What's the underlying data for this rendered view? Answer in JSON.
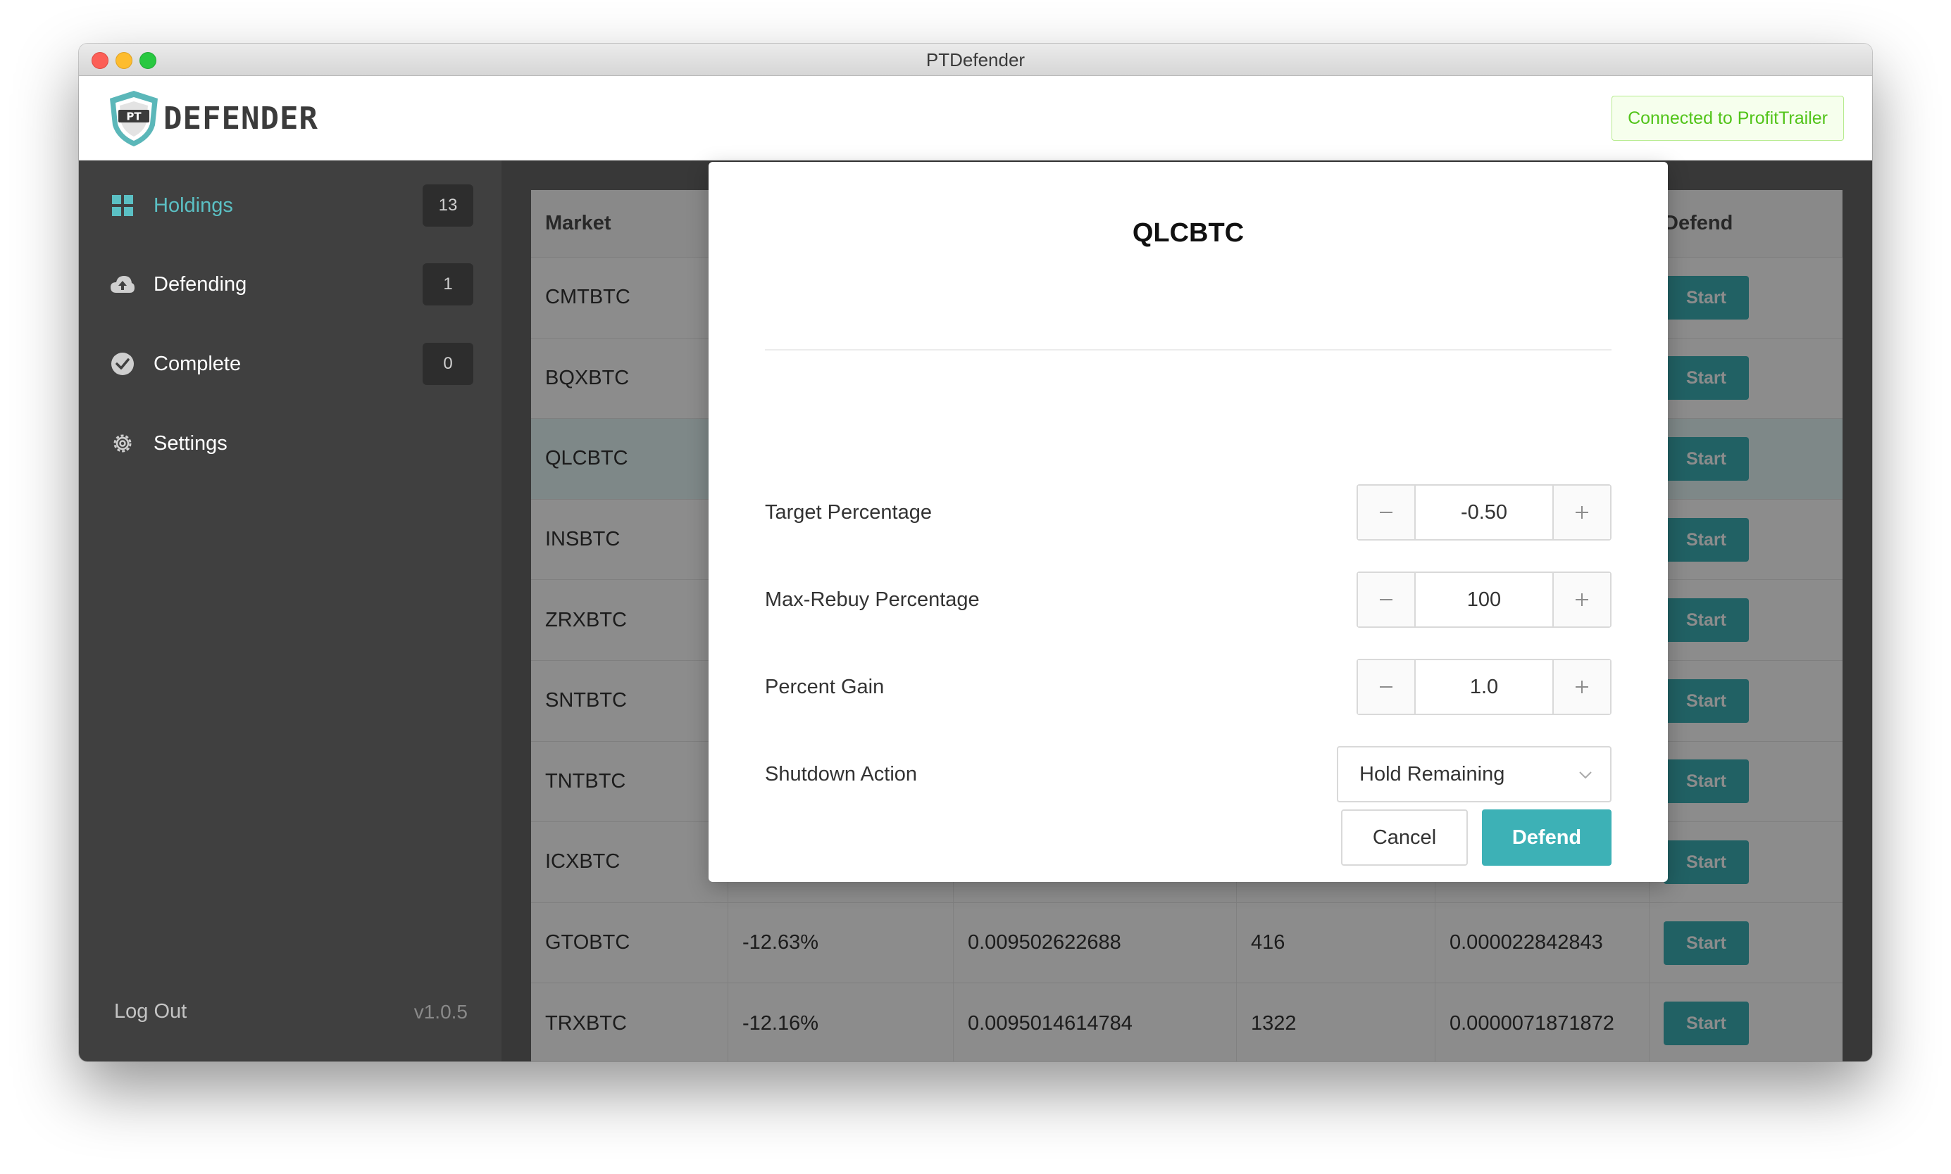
{
  "window": {
    "title": "PTDefender"
  },
  "header": {
    "logo_text": "DEFENDER",
    "logo_badge": "PT",
    "status": "Connected to ProfitTrailer"
  },
  "sidebar": {
    "items": [
      {
        "label": "Holdings",
        "badge": "13",
        "icon": "grid-icon",
        "active": true
      },
      {
        "label": "Defending",
        "badge": "1",
        "icon": "cloud-upload-icon"
      },
      {
        "label": "Complete",
        "badge": "0",
        "icon": "check-circle-icon"
      },
      {
        "label": "Settings",
        "icon": "gear-icon"
      }
    ],
    "logout": "Log Out",
    "version": "v1.0.5"
  },
  "table": {
    "columns": [
      "Market",
      "",
      "",
      "",
      "",
      "Defend"
    ],
    "start_label": "Start",
    "rows": [
      {
        "market": "CMTBTC"
      },
      {
        "market": "BQXBTC"
      },
      {
        "market": "QLCBTC",
        "selected": true
      },
      {
        "market": "INSBTC"
      },
      {
        "market": "ZRXBTC"
      },
      {
        "market": "SNTBTC"
      },
      {
        "market": "TNTBTC"
      },
      {
        "market": "ICXBTC"
      },
      {
        "market": "GTOBTC",
        "c2": "-12.63%",
        "c3": "0.009502622688",
        "c4": "416",
        "c5": "0.000022842843"
      },
      {
        "market": "TRXBTC",
        "c2": "-12.16%",
        "c3": "0.0095014614784",
        "c4": "1322",
        "c5": "0.0000071871872"
      }
    ]
  },
  "modal": {
    "title": "QLCBTC",
    "fields": {
      "target": {
        "label": "Target Percentage",
        "value": "-0.50"
      },
      "rebuy": {
        "label": "Max-Rebuy Percentage",
        "value": "100"
      },
      "gain": {
        "label": "Percent Gain",
        "value": "1.0"
      }
    },
    "shutdown": {
      "label": "Shutdown Action",
      "value": "Hold Remaining"
    },
    "cancel_label": "Cancel",
    "defend_label": "Defend"
  },
  "colors": {
    "accent": "#3db1b6",
    "sidebar_bg": "#404040",
    "success": "#52c41a"
  }
}
